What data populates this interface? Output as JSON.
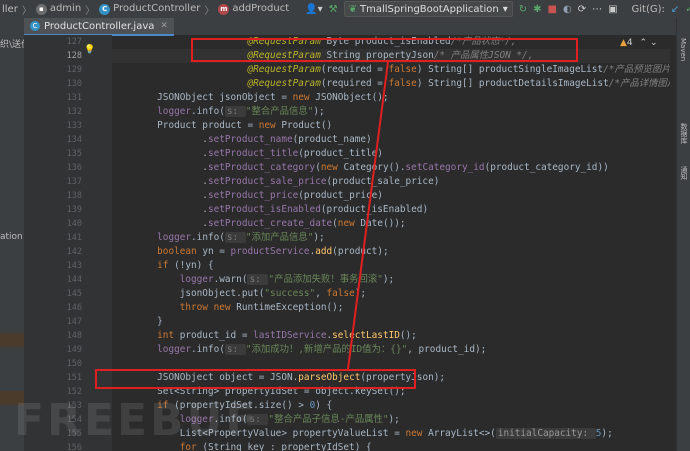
{
  "topbar": {
    "breadcrumbs": [
      "ller",
      "admin",
      "ProductController",
      "addProduct"
    ],
    "run_config": "TmallSpringBootApplication",
    "git_label": "Git(G):"
  },
  "tab": {
    "label": "ProductController.java"
  },
  "left_panel": {
    "top_text": "织\\送价",
    "mid_text": "ation"
  },
  "gutter": {
    "line_numbers": [
      "127",
      "128",
      "129",
      "130",
      "131",
      "132",
      "133",
      "134",
      "135",
      "136",
      "137",
      "138",
      "139",
      "140",
      "141",
      "142",
      "143",
      "144",
      "145",
      "146",
      "147",
      "148",
      "149",
      "150",
      "151",
      "152",
      "153",
      "154",
      "155",
      "156"
    ],
    "current_line": "128"
  },
  "inspections": {
    "warning_count": "4"
  },
  "right_strip": {
    "labels": [
      "Maven",
      "数据库",
      "通知"
    ]
  },
  "code_lines": [
    [
      {
        "c": "                        "
      },
      {
        "c": "@RequestParam ",
        "k": "ann"
      },
      {
        "c": "Byte ",
        "k": ""
      },
      {
        "c": "product_isEnabled",
        "k": ""
      },
      {
        "c": "/*产品状态*/,",
        "k": "cmt"
      }
    ],
    [
      {
        "c": "                        "
      },
      {
        "c": "@RequestParam ",
        "k": "ann"
      },
      {
        "c": "String propertyJson"
      },
      {
        "c": "/* 产品属性JSON */,",
        "k": "cmt"
      }
    ],
    [
      {
        "c": "                        "
      },
      {
        "c": "@RequestParam",
        "k": "ann"
      },
      {
        "c": "(required = "
      },
      {
        "c": "false",
        "k": "kw"
      },
      {
        "c": ") String[] productSingleImageList"
      },
      {
        "c": "/*产品预览图片名称数组*/,",
        "k": "cmt"
      }
    ],
    [
      {
        "c": "                        "
      },
      {
        "c": "@RequestParam",
        "k": "ann"
      },
      {
        "c": "(required = "
      },
      {
        "c": "false",
        "k": "kw"
      },
      {
        "c": ") String[] productDetailsImageList"
      },
      {
        "c": "/*产品详情图片名称数组*/",
        "k": "cmt"
      }
    ],
    [
      {
        "c": "        JSONObject jsonObject = "
      },
      {
        "c": "new ",
        "k": "kw"
      },
      {
        "c": "JSONObject();"
      }
    ],
    [
      {
        "c": "        "
      },
      {
        "c": "logger",
        "k": "fld"
      },
      {
        "c": ".info("
      },
      {
        "c": "s: ",
        "k": "hint"
      },
      {
        "c": "\"整合产品信息\"",
        "k": "str"
      },
      {
        "c": ");"
      }
    ],
    [
      {
        "c": "        Product product = "
      },
      {
        "c": "new ",
        "k": "kw"
      },
      {
        "c": "Product()"
      }
    ],
    [
      {
        "c": "                ."
      },
      {
        "c": "setProduct_name",
        "k": "fld"
      },
      {
        "c": "(product_name)"
      }
    ],
    [
      {
        "c": "                ."
      },
      {
        "c": "setProduct_title",
        "k": "fld"
      },
      {
        "c": "(product_title)"
      }
    ],
    [
      {
        "c": "                ."
      },
      {
        "c": "setProduct_category",
        "k": "fld"
      },
      {
        "c": "("
      },
      {
        "c": "new ",
        "k": "kw"
      },
      {
        "c": "Category()."
      },
      {
        "c": "setCategory_id",
        "k": "fld"
      },
      {
        "c": "(product_category_id))"
      }
    ],
    [
      {
        "c": "                ."
      },
      {
        "c": "setProduct_sale_price",
        "k": "fld"
      },
      {
        "c": "(product_sale_price)"
      }
    ],
    [
      {
        "c": "                ."
      },
      {
        "c": "setProduct_price",
        "k": "fld"
      },
      {
        "c": "(product_price)"
      }
    ],
    [
      {
        "c": "                ."
      },
      {
        "c": "setProduct_isEnabled",
        "k": "fld"
      },
      {
        "c": "(product_isEnabled)"
      }
    ],
    [
      {
        "c": "                ."
      },
      {
        "c": "setProduct_create_date",
        "k": "fld"
      },
      {
        "c": "("
      },
      {
        "c": "new ",
        "k": "kw"
      },
      {
        "c": "Date());"
      }
    ],
    [
      {
        "c": "        "
      },
      {
        "c": "logger",
        "k": "fld"
      },
      {
        "c": ".info("
      },
      {
        "c": "s: ",
        "k": "hint"
      },
      {
        "c": "\"添加产品信息\"",
        "k": "str"
      },
      {
        "c": ");"
      }
    ],
    [
      {
        "c": "        "
      },
      {
        "c": "boolean ",
        "k": "kw"
      },
      {
        "c": "yn = "
      },
      {
        "c": "productService",
        "k": "fld"
      },
      {
        "c": "."
      },
      {
        "c": "add",
        "k": "mth"
      },
      {
        "c": "(product);"
      }
    ],
    [
      {
        "c": "        "
      },
      {
        "c": "if ",
        "k": "kw"
      },
      {
        "c": "(!yn) {"
      }
    ],
    [
      {
        "c": "            "
      },
      {
        "c": "logger",
        "k": "fld"
      },
      {
        "c": ".warn("
      },
      {
        "c": "s: ",
        "k": "hint"
      },
      {
        "c": "\"产品添加失败！事务回滚\"",
        "k": "str"
      },
      {
        "c": ");"
      }
    ],
    [
      {
        "c": "            jsonObject.put("
      },
      {
        "c": "\"success\"",
        "k": "str"
      },
      {
        "c": ", "
      },
      {
        "c": "false",
        "k": "kw"
      },
      {
        "c": ");"
      }
    ],
    [
      {
        "c": "            "
      },
      {
        "c": "throw new ",
        "k": "kw"
      },
      {
        "c": "RuntimeException();"
      }
    ],
    [
      {
        "c": "        }"
      }
    ],
    [
      {
        "c": "        "
      },
      {
        "c": "int ",
        "k": "kw"
      },
      {
        "c": "product_id = "
      },
      {
        "c": "lastIDService",
        "k": "fld"
      },
      {
        "c": "."
      },
      {
        "c": "selectLastID",
        "k": "mth"
      },
      {
        "c": "();"
      }
    ],
    [
      {
        "c": "        "
      },
      {
        "c": "logger",
        "k": "fld"
      },
      {
        "c": ".info("
      },
      {
        "c": "s: ",
        "k": "hint"
      },
      {
        "c": "\"添加成功！,新增产品的ID值为：{}\"",
        "k": "str"
      },
      {
        "c": ", product_id);"
      }
    ],
    [
      {
        "c": ""
      }
    ],
    [
      {
        "c": "        JSONObject object = JSON."
      },
      {
        "c": "parseObject",
        "k": "mth"
      },
      {
        "c": "(propertyJson);"
      }
    ],
    [
      {
        "c": "        Set<String> propertyIdSet = object.keySet();"
      }
    ],
    [
      {
        "c": "        "
      },
      {
        "c": "if ",
        "k": "kw"
      },
      {
        "c": "(propertyIdSet.size() > "
      },
      {
        "c": "0",
        "k": "num"
      },
      {
        "c": ") {"
      }
    ],
    [
      {
        "c": "            "
      },
      {
        "c": "logger",
        "k": "fld"
      },
      {
        "c": ".info("
      },
      {
        "c": "s: ",
        "k": "hint"
      },
      {
        "c": "\"整合产品子信息-产品属性\"",
        "k": "str"
      },
      {
        "c": ");"
      }
    ],
    [
      {
        "c": "            List<PropertyValue> propertyValueList = "
      },
      {
        "c": "new ",
        "k": "kw"
      },
      {
        "c": "ArrayList<>("
      },
      {
        "c": "initialCapacity: ",
        "k": "hint2"
      },
      {
        "c": "5",
        "k": "num"
      },
      {
        "c": ");"
      }
    ],
    [
      {
        "c": "            "
      },
      {
        "c": "for ",
        "k": "kw"
      },
      {
        "c": "(String key : propertyIdSet) {"
      }
    ]
  ],
  "watermark": "FREEBUF",
  "colors": {
    "highlight_red": "#e02020",
    "editor_bg": "#2b2b2b",
    "keyword": "#cc7832",
    "string": "#6a8759",
    "annotation": "#bbb529"
  }
}
